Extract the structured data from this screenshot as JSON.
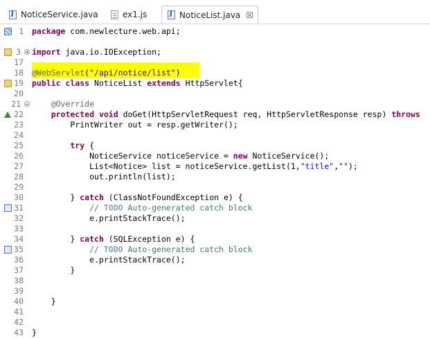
{
  "tabs": [
    {
      "label": "NoticeService.java",
      "icon": "java-file-icon",
      "active": false
    },
    {
      "label": "ex1.js",
      "icon": "js-file-icon",
      "active": false
    },
    {
      "label": "NoticeList.java",
      "icon": "java-file-icon",
      "active": true,
      "close": "☒"
    }
  ],
  "lines": [
    {
      "num": "1"
    },
    {
      "num": ""
    },
    {
      "num": "3"
    },
    {
      "num": "17"
    },
    {
      "num": "18"
    },
    {
      "num": "19"
    },
    {
      "num": "20"
    },
    {
      "num": "21"
    },
    {
      "num": "22"
    },
    {
      "num": "23"
    },
    {
      "num": "24"
    },
    {
      "num": "25"
    },
    {
      "num": "26"
    },
    {
      "num": "27"
    },
    {
      "num": "28"
    },
    {
      "num": "29"
    },
    {
      "num": "30"
    },
    {
      "num": "31"
    },
    {
      "num": "32"
    },
    {
      "num": "33"
    },
    {
      "num": "34"
    },
    {
      "num": "35"
    },
    {
      "num": "36"
    },
    {
      "num": "37"
    },
    {
      "num": "38"
    },
    {
      "num": "39"
    },
    {
      "num": "40"
    },
    {
      "num": "41"
    },
    {
      "num": "42"
    },
    {
      "num": "43"
    }
  ],
  "code": {
    "l1_kw": "package",
    "l1_rest": " com.newlecture.web.api;",
    "l3_kw": "import",
    "l3_rest": " java.io.IOException;",
    "l18_ann": "@WebServlet",
    "l18_p1": "(",
    "l18_str": "\"/api/notice/list\"",
    "l18_p2": ")",
    "l19_kw1": "public",
    "l19_kw2": "class",
    "l19_name": " NoticeList ",
    "l19_kw3": "extends",
    "l19_rest": " HttpServlet{",
    "l21_ann": "    @Override",
    "l22_kw1": "    protected",
    "l22_kw2": "void",
    "l22_rest": " doGet(HttpServletRequest req, HttpServletResponse resp) ",
    "l22_kw3": "throws",
    "l23": "        PrintWriter out = resp.getWriter();",
    "l25_kw": "        try",
    "l25_rest": " {",
    "l26_a": "            NoticeService noticeService = ",
    "l26_kw": "new",
    "l26_b": " NoticeService();",
    "l27_a": "            List<Notice> list = noticeService.getList(1,",
    "l27_str1": "\"title\"",
    "l27_c": ",",
    "l27_str2": "\"\"",
    "l27_d": ");",
    "l28": "            out.println(list);",
    "l30_a": "        } ",
    "l30_kw": "catch",
    "l30_b": " (ClassNotFoundException e) {",
    "l31_c1": "            // ",
    "l31_todo": "TODO",
    "l31_c2": " Auto-generated catch block",
    "l32": "            e.printStackTrace();",
    "l34_a": "        } ",
    "l34_kw": "catch",
    "l34_b": " (SQLException e) {",
    "l35_c1": "            // ",
    "l35_todo": "TODO",
    "l35_c2": " Auto-generated catch block",
    "l36": "            e.printStackTrace();",
    "l37": "        }",
    "l40": "    }",
    "l43": "}"
  },
  "colors": {
    "keyword": "#7f0055",
    "string": "#2a00ff",
    "comment": "#3f7f5f",
    "annotation": "#646464",
    "highlight": "#ffff00"
  }
}
